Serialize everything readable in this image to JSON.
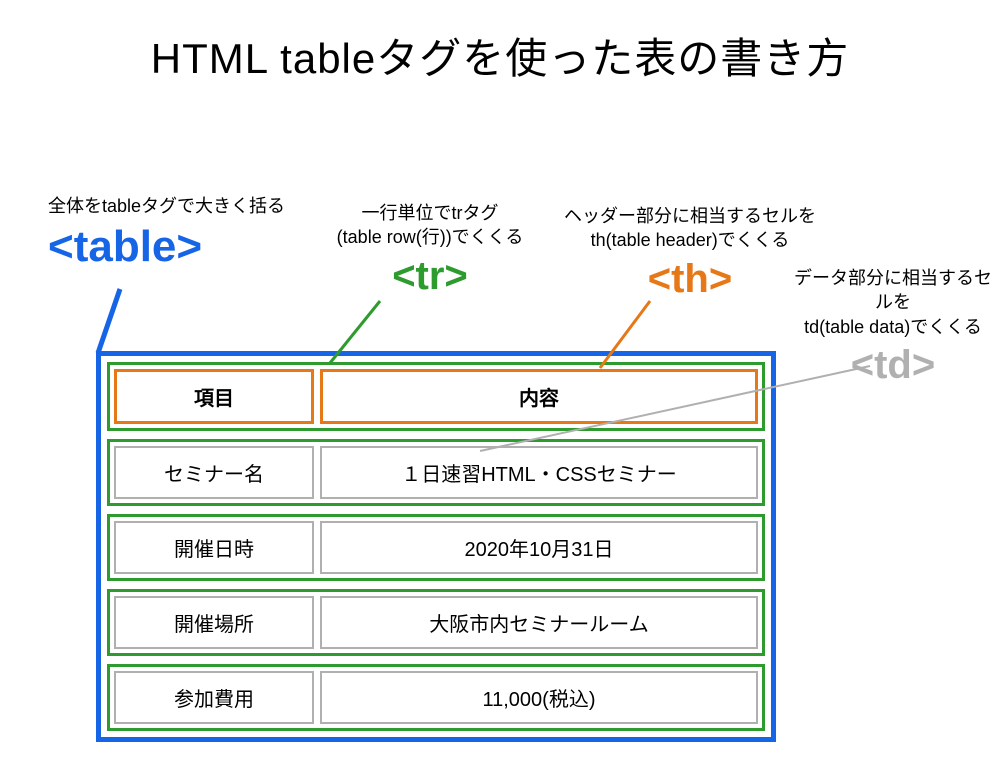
{
  "title": "HTML tableタグを使った表の書き方",
  "annotations": {
    "table": {
      "desc": "全体をtableタグで大きく括る",
      "tag": "<table>"
    },
    "tr": {
      "desc1": "一行単位でtrタグ",
      "desc2": "(table row(行))でくくる",
      "tag": "<tr>"
    },
    "th": {
      "desc1": "ヘッダー部分に相当するセルを",
      "desc2": "th(table header)でくくる",
      "tag": "<th>"
    },
    "td": {
      "desc1": "データ部分に相当するセルを",
      "desc2": "td(table data)でくくる",
      "tag": "<td>"
    }
  },
  "table": {
    "header": {
      "col1": "項目",
      "col2": "内容"
    },
    "rows": [
      {
        "col1": "セミナー名",
        "col2": "１日速習HTML・CSSセミナー"
      },
      {
        "col1": "開催日時",
        "col2": "2020年10月31日"
      },
      {
        "col1": "開催場所",
        "col2": "大阪市内セミナールーム"
      },
      {
        "col1": "参加費用",
        "col2": "11,000(税込)"
      }
    ]
  },
  "colors": {
    "table": "#1565e6",
    "tr": "#2e9b2e",
    "th": "#e67817",
    "td": "#b0b0b0"
  }
}
